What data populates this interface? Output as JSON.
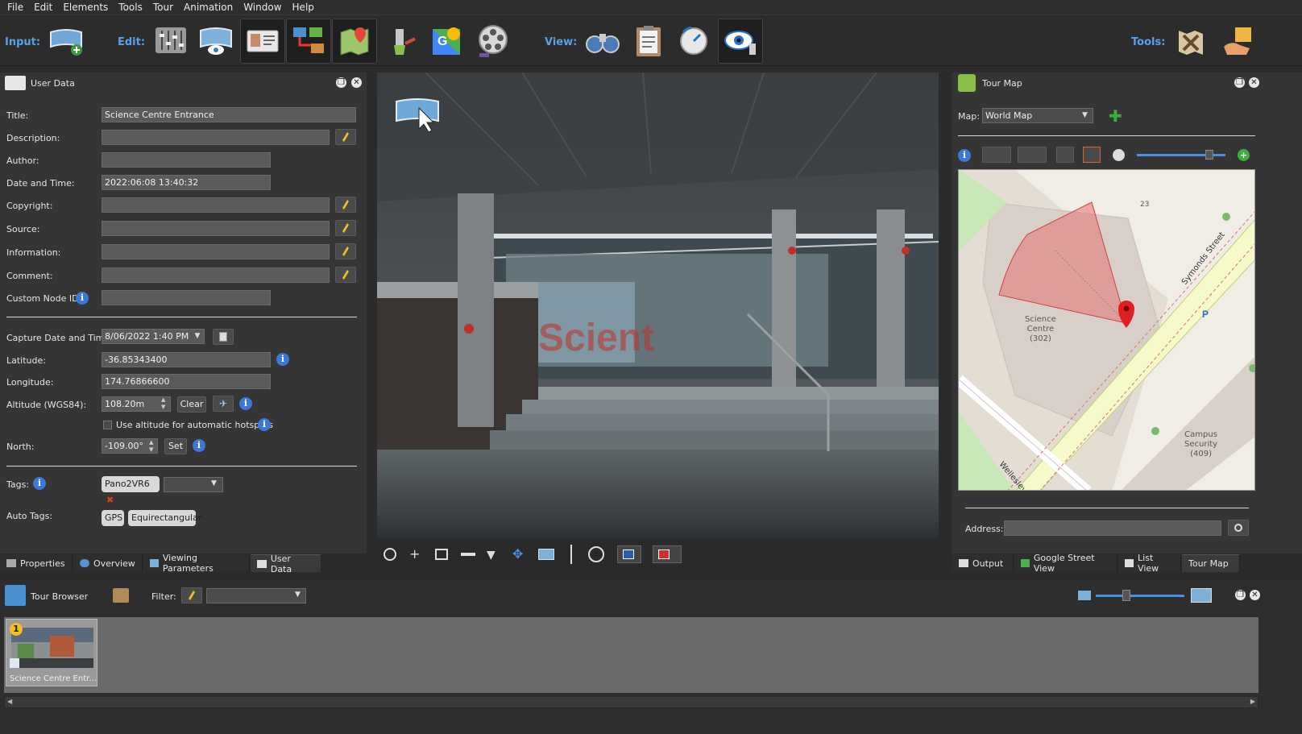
{
  "menu": [
    "File",
    "Edit",
    "Elements",
    "Tools",
    "Tour",
    "Animation",
    "Window",
    "Help"
  ],
  "toolbar": {
    "input_label": "Input:",
    "edit_label": "Edit:",
    "view_label": "View:",
    "tools_label": "Tools:"
  },
  "user_data": {
    "title": "User Data",
    "fields": {
      "title_label": "Title:",
      "title_value": "Science Centre Entrance",
      "description_label": "Description:",
      "author_label": "Author:",
      "datetime_label": "Date and Time:",
      "datetime_value": "2022:06:08 13:40:32",
      "copyright_label": "Copyright:",
      "source_label": "Source:",
      "information_label": "Information:",
      "comment_label": "Comment:",
      "custom_node_label": "Custom Node ID:"
    },
    "capture": {
      "capture_label": "Capture Date and Time:",
      "capture_value": "8/06/2022 1:40 PM",
      "latitude_label": "Latitude:",
      "latitude_value": "-36.85343400",
      "longitude_label": "Longitude:",
      "longitude_value": "174.76866600",
      "altitude_label": "Altitude (WGS84):",
      "altitude_value": "108.20m",
      "clear_label": "Clear",
      "use_altitude_label": "Use altitude for automatic hotspots",
      "north_label": "North:",
      "north_value": "-109.00°",
      "set_label": "Set"
    },
    "tags_label": "Tags:",
    "tag_chip": "Pano2VR6",
    "auto_tags_label": "Auto Tags:",
    "auto_tags": [
      "GPS",
      "Equirectangular"
    ]
  },
  "left_tabs": [
    "Properties",
    "Overview",
    "Viewing Parameters",
    "User Data"
  ],
  "right_tabs": [
    "Output",
    "Google Street View",
    "List View",
    "Tour Map"
  ],
  "tour_map": {
    "title": "Tour Map",
    "map_label": "Map:",
    "map_value": "World Map",
    "address_label": "Address:",
    "map_labels": {
      "building_num": "23",
      "street": "Symonds Street",
      "science_centre": "Science\nCentre\n(302)",
      "campus_security": "Campus\nSecurity\n(409)",
      "wellesley": "Wellesley"
    }
  },
  "tour_browser": {
    "title": "Tour Browser",
    "filter_label": "Filter:",
    "node_label": "Science Centre Entr...",
    "node_number": "1"
  },
  "colors": {
    "accent_blue": "#5aa0e6",
    "map_cone": "#e57373",
    "map_pin": "#e02020"
  }
}
